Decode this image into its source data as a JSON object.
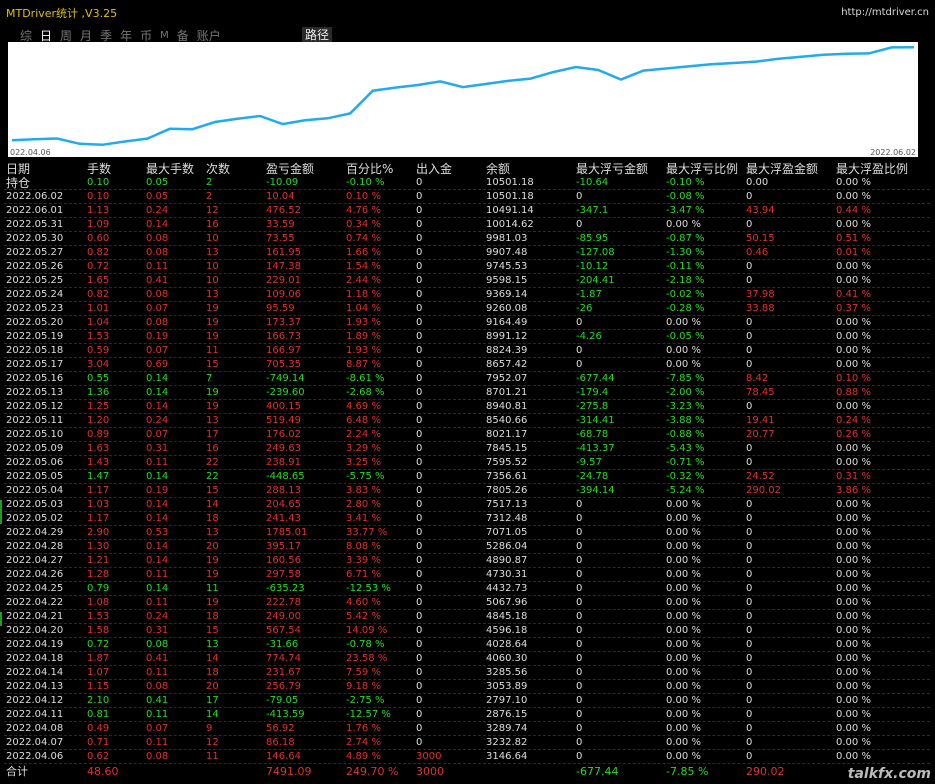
{
  "app": {
    "title": "MTDriver统计 ,V3.25",
    "url": "http://mtdriver.cn",
    "watermark": "talkfx.com"
  },
  "tabs": [
    {
      "label": "综",
      "active": false
    },
    {
      "label": "日",
      "active": true
    },
    {
      "label": "周",
      "active": false
    },
    {
      "label": "月",
      "active": false
    },
    {
      "label": "季",
      "active": false
    },
    {
      "label": "年",
      "active": false
    },
    {
      "label": "币",
      "active": false
    },
    {
      "label": "M",
      "active": false
    },
    {
      "label": "备",
      "active": false
    },
    {
      "label": "账户",
      "active": false
    }
  ],
  "path_button": "路径",
  "chart": {
    "start_label": "022.04.06",
    "end_label": "2022.06.02",
    "line_color": "#22aaee"
  },
  "chart_data": {
    "type": "line",
    "x": [
      "2022.04.06",
      "2022.04.07",
      "2022.04.08",
      "2022.04.11",
      "2022.04.12",
      "2022.04.13",
      "2022.04.14",
      "2022.04.18",
      "2022.04.19",
      "2022.04.20",
      "2022.04.21",
      "2022.04.22",
      "2022.04.25",
      "2022.04.26",
      "2022.04.27",
      "2022.04.28",
      "2022.04.29",
      "2022.05.02",
      "2022.05.03",
      "2022.05.04",
      "2022.05.05",
      "2022.05.06",
      "2022.05.09",
      "2022.05.10",
      "2022.05.11",
      "2022.05.12",
      "2022.05.13",
      "2022.05.16",
      "2022.05.17",
      "2022.05.18",
      "2022.05.19",
      "2022.05.20",
      "2022.05.23",
      "2022.05.24",
      "2022.05.25",
      "2022.05.26",
      "2022.05.27",
      "2022.05.30",
      "2022.05.31",
      "2022.06.01",
      "2022.06.02"
    ],
    "series": [
      {
        "values": [
          3146.64,
          3232.82,
          3289.74,
          2876.15,
          2797.1,
          3053.89,
          3285.56,
          4060.3,
          4028.64,
          4596.18,
          4845.18,
          5067.96,
          4432.73,
          4730.31,
          4890.87,
          5286.04,
          7071.05,
          7312.48,
          7517.13,
          7805.26,
          7356.61,
          7595.52,
          7845.15,
          8021.17,
          8540.66,
          8940.81,
          8701.21,
          7952.07,
          8657.42,
          8824.39,
          8991.12,
          9164.49,
          9260.08,
          9369.14,
          9598.15,
          9745.53,
          9907.48,
          9981.03,
          10014.62,
          10491.14,
          10501.18
        ]
      }
    ],
    "ylim": [
      2700,
      10600
    ]
  },
  "columns": [
    "日期",
    "手数",
    "最大手数",
    "次数",
    "盈亏金额",
    "百分比%",
    "出入金",
    "余额",
    "最大浮亏金额",
    "最大浮亏比例",
    "最大浮盈金额",
    "最大浮盈比例"
  ],
  "position": {
    "date": "持仓",
    "lots": "0.10",
    "max_lots": "0.05",
    "count": "2",
    "pl": "-10.09",
    "pct": "-0.10 %",
    "io": "0",
    "balance": "10501.18",
    "max_fl": "-10.64",
    "max_fl_pct": "-0.10 %",
    "max_fp": "0.00",
    "max_fp_pct": "0.00 %"
  },
  "rows": [
    {
      "date": "2022.06.02",
      "lots": "0.10",
      "max_lots": "0.05",
      "count": "2",
      "pl": "10.04",
      "pct": "0.10 %",
      "io": "0",
      "balance": "10501.18",
      "max_fl": "0",
      "max_fl_pct": "-0.08 %",
      "max_fp": "0",
      "max_fp_pct": "0.00 %"
    },
    {
      "date": "2022.06.01",
      "lots": "1.13",
      "max_lots": "0.24",
      "count": "12",
      "pl": "476.52",
      "pct": "4.76 %",
      "io": "0",
      "balance": "10491.14",
      "max_fl": "-347.1",
      "max_fl_pct": "-3.47 %",
      "max_fp": "43.94",
      "max_fp_pct": "0.44 %"
    },
    {
      "date": "2022.05.31",
      "lots": "1.09",
      "max_lots": "0.14",
      "count": "16",
      "pl": "33.59",
      "pct": "0.34 %",
      "io": "0",
      "balance": "10014.62",
      "max_fl": "0",
      "max_fl_pct": "0.00 %",
      "max_fp": "0",
      "max_fp_pct": "0.00 %"
    },
    {
      "date": "2022.05.30",
      "lots": "0.60",
      "max_lots": "0.08",
      "count": "10",
      "pl": "73.55",
      "pct": "0.74 %",
      "io": "0",
      "balance": "9981.03",
      "max_fl": "-85.95",
      "max_fl_pct": "-0.87 %",
      "max_fp": "50.15",
      "max_fp_pct": "0.51 %"
    },
    {
      "date": "2022.05.27",
      "lots": "0.82",
      "max_lots": "0.08",
      "count": "13",
      "pl": "161.95",
      "pct": "1.66 %",
      "io": "0",
      "balance": "9907.48",
      "max_fl": "-127.08",
      "max_fl_pct": "-1.30 %",
      "max_fp": "0.46",
      "max_fp_pct": "0.01 %"
    },
    {
      "date": "2022.05.26",
      "lots": "0.72",
      "max_lots": "0.11",
      "count": "10",
      "pl": "147.38",
      "pct": "1.54 %",
      "io": "0",
      "balance": "9745.53",
      "max_fl": "-10.12",
      "max_fl_pct": "-0.11 %",
      "max_fp": "0",
      "max_fp_pct": "0.00 %"
    },
    {
      "date": "2022.05.25",
      "lots": "1.65",
      "max_lots": "0.41",
      "count": "10",
      "pl": "229.01",
      "pct": "2.44 %",
      "io": "0",
      "balance": "9598.15",
      "max_fl": "-204.41",
      "max_fl_pct": "-2.18 %",
      "max_fp": "0",
      "max_fp_pct": "0.00 %"
    },
    {
      "date": "2022.05.24",
      "lots": "0.82",
      "max_lots": "0.08",
      "count": "13",
      "pl": "109.06",
      "pct": "1.18 %",
      "io": "0",
      "balance": "9369.14",
      "max_fl": "-1.87",
      "max_fl_pct": "-0.02 %",
      "max_fp": "37.98",
      "max_fp_pct": "0.41 %"
    },
    {
      "date": "2022.05.23",
      "lots": "1.01",
      "max_lots": "0.07",
      "count": "19",
      "pl": "95.59",
      "pct": "1.04 %",
      "io": "0",
      "balance": "9260.08",
      "max_fl": "-26",
      "max_fl_pct": "-0.28 %",
      "max_fp": "33.88",
      "max_fp_pct": "0.37 %"
    },
    {
      "date": "2022.05.20",
      "lots": "1.04",
      "max_lots": "0.08",
      "count": "19",
      "pl": "173.37",
      "pct": "1.93 %",
      "io": "0",
      "balance": "9164.49",
      "max_fl": "0",
      "max_fl_pct": "0.00 %",
      "max_fp": "0",
      "max_fp_pct": "0.00 %"
    },
    {
      "date": "2022.05.19",
      "lots": "1.53",
      "max_lots": "0.19",
      "count": "19",
      "pl": "166.73",
      "pct": "1.89 %",
      "io": "0",
      "balance": "8991.12",
      "max_fl": "-4.26",
      "max_fl_pct": "-0.05 %",
      "max_fp": "0",
      "max_fp_pct": "0.00 %"
    },
    {
      "date": "2022.05.18",
      "lots": "0.59",
      "max_lots": "0.07",
      "count": "11",
      "pl": "166.97",
      "pct": "1.93 %",
      "io": "0",
      "balance": "8824.39",
      "max_fl": "0",
      "max_fl_pct": "0.00 %",
      "max_fp": "0",
      "max_fp_pct": "0.00 %"
    },
    {
      "date": "2022.05.17",
      "lots": "3.04",
      "max_lots": "0.69",
      "count": "15",
      "pl": "705.35",
      "pct": "8.87 %",
      "io": "0",
      "balance": "8657.42",
      "max_fl": "0",
      "max_fl_pct": "0.00 %",
      "max_fp": "0",
      "max_fp_pct": "0.00 %"
    },
    {
      "date": "2022.05.16",
      "lots": "0.55",
      "max_lots": "0.14",
      "count": "7",
      "pl": "-749.14",
      "pct": "-8.61 %",
      "io": "0",
      "balance": "7952.07",
      "max_fl": "-677.44",
      "max_fl_pct": "-7.85 %",
      "max_fp": "8.42",
      "max_fp_pct": "0.10 %"
    },
    {
      "date": "2022.05.13",
      "lots": "1.36",
      "max_lots": "0.14",
      "count": "19",
      "pl": "-239.60",
      "pct": "-2.68 %",
      "io": "0",
      "balance": "8701.21",
      "max_fl": "-179.4",
      "max_fl_pct": "-2.00 %",
      "max_fp": "78.45",
      "max_fp_pct": "0.88 %"
    },
    {
      "date": "2022.05.12",
      "lots": "1.25",
      "max_lots": "0.14",
      "count": "19",
      "pl": "400.15",
      "pct": "4.69 %",
      "io": "0",
      "balance": "8940.81",
      "max_fl": "-275.8",
      "max_fl_pct": "-3.23 %",
      "max_fp": "0",
      "max_fp_pct": "0.00 %"
    },
    {
      "date": "2022.05.11",
      "lots": "1.20",
      "max_lots": "0.24",
      "count": "13",
      "pl": "519.49",
      "pct": "6.48 %",
      "io": "0",
      "balance": "8540.66",
      "max_fl": "-314.41",
      "max_fl_pct": "-3.88 %",
      "max_fp": "19.41",
      "max_fp_pct": "0.24 %"
    },
    {
      "date": "2022.05.10",
      "lots": "0.89",
      "max_lots": "0.07",
      "count": "17",
      "pl": "176.02",
      "pct": "2.24 %",
      "io": "0",
      "balance": "8021.17",
      "max_fl": "-68.78",
      "max_fl_pct": "-0.88 %",
      "max_fp": "20.77",
      "max_fp_pct": "0.26 %"
    },
    {
      "date": "2022.05.09",
      "lots": "1.63",
      "max_lots": "0.31",
      "count": "16",
      "pl": "249.63",
      "pct": "3.29 %",
      "io": "0",
      "balance": "7845.15",
      "max_fl": "-413.37",
      "max_fl_pct": "-5.43 %",
      "max_fp": "0",
      "max_fp_pct": "0.00 %"
    },
    {
      "date": "2022.05.06",
      "lots": "1.43",
      "max_lots": "0.11",
      "count": "22",
      "pl": "238.91",
      "pct": "3.25 %",
      "io": "0",
      "balance": "7595.52",
      "max_fl": "-9.57",
      "max_fl_pct": "-0.71 %",
      "max_fp": "0",
      "max_fp_pct": "0.00 %"
    },
    {
      "date": "2022.05.05",
      "lots": "1.47",
      "max_lots": "0.14",
      "count": "22",
      "pl": "-448.65",
      "pct": "-5.75 %",
      "io": "0",
      "balance": "7356.61",
      "max_fl": "-24.78",
      "max_fl_pct": "-0.32 %",
      "max_fp": "24.52",
      "max_fp_pct": "0.31 %"
    },
    {
      "date": "2022.05.04",
      "lots": "1.17",
      "max_lots": "0.19",
      "count": "15",
      "pl": "288.13",
      "pct": "3.83 %",
      "io": "0",
      "balance": "7805.26",
      "max_fl": "-394.14",
      "max_fl_pct": "-5.24 %",
      "max_fp": "290.02",
      "max_fp_pct": "3.86 %"
    },
    {
      "date": "2022.05.03",
      "lots": "1.03",
      "max_lots": "0.14",
      "count": "14",
      "pl": "204.65",
      "pct": "2.80 %",
      "io": "0",
      "balance": "7517.13",
      "max_fl": "0",
      "max_fl_pct": "0.00 %",
      "max_fp": "0",
      "max_fp_pct": "0.00 %"
    },
    {
      "date": "2022.05.02",
      "lots": "1.17",
      "max_lots": "0.14",
      "count": "18",
      "pl": "241.43",
      "pct": "3.41 %",
      "io": "0",
      "balance": "7312.48",
      "max_fl": "0",
      "max_fl_pct": "0.00 %",
      "max_fp": "0",
      "max_fp_pct": "0.00 %"
    },
    {
      "date": "2022.04.29",
      "lots": "2.90",
      "max_lots": "0.53",
      "count": "13",
      "pl": "1785.01",
      "pct": "33.77 %",
      "io": "0",
      "balance": "7071.05",
      "max_fl": "0",
      "max_fl_pct": "0.00 %",
      "max_fp": "0",
      "max_fp_pct": "0.00 %"
    },
    {
      "date": "2022.04.28",
      "lots": "1.30",
      "max_lots": "0.14",
      "count": "20",
      "pl": "395.17",
      "pct": "8.08 %",
      "io": "0",
      "balance": "5286.04",
      "max_fl": "0",
      "max_fl_pct": "0.00 %",
      "max_fp": "0",
      "max_fp_pct": "0.00 %"
    },
    {
      "date": "2022.04.27",
      "lots": "1.21",
      "max_lots": "0.14",
      "count": "19",
      "pl": "160.56",
      "pct": "3.39 %",
      "io": "0",
      "balance": "4890.87",
      "max_fl": "0",
      "max_fl_pct": "0.00 %",
      "max_fp": "0",
      "max_fp_pct": "0.00 %"
    },
    {
      "date": "2022.04.26",
      "lots": "1.28",
      "max_lots": "0.11",
      "count": "19",
      "pl": "297.58",
      "pct": "6.71 %",
      "io": "0",
      "balance": "4730.31",
      "max_fl": "0",
      "max_fl_pct": "0.00 %",
      "max_fp": "0",
      "max_fp_pct": "0.00 %"
    },
    {
      "date": "2022.04.25",
      "lots": "0.79",
      "max_lots": "0.14",
      "count": "11",
      "pl": "-635.23",
      "pct": "-12.53 %",
      "io": "0",
      "balance": "4432.73",
      "max_fl": "0",
      "max_fl_pct": "0.00 %",
      "max_fp": "0",
      "max_fp_pct": "0.00 %"
    },
    {
      "date": "2022.04.22",
      "lots": "1.08",
      "max_lots": "0.11",
      "count": "19",
      "pl": "222.78",
      "pct": "4.60 %",
      "io": "0",
      "balance": "5067.96",
      "max_fl": "0",
      "max_fl_pct": "0.00 %",
      "max_fp": "0",
      "max_fp_pct": "0.00 %"
    },
    {
      "date": "2022.04.21",
      "lots": "1.53",
      "max_lots": "0.24",
      "count": "18",
      "pl": "249.00",
      "pct": "5.42 %",
      "io": "0",
      "balance": "4845.18",
      "max_fl": "0",
      "max_fl_pct": "0.00 %",
      "max_fp": "0",
      "max_fp_pct": "0.00 %"
    },
    {
      "date": "2022.04.20",
      "lots": "1.58",
      "max_lots": "0.31",
      "count": "15",
      "pl": "567.54",
      "pct": "14.09 %",
      "io": "0",
      "balance": "4596.18",
      "max_fl": "0",
      "max_fl_pct": "0.00 %",
      "max_fp": "0",
      "max_fp_pct": "0.00 %"
    },
    {
      "date": "2022.04.19",
      "lots": "0.72",
      "max_lots": "0.08",
      "count": "13",
      "pl": "-31.66",
      "pct": "-0.78 %",
      "io": "0",
      "balance": "4028.64",
      "max_fl": "0",
      "max_fl_pct": "0.00 %",
      "max_fp": "0",
      "max_fp_pct": "0.00 %"
    },
    {
      "date": "2022.04.18",
      "lots": "1.87",
      "max_lots": "0.41",
      "count": "14",
      "pl": "774.74",
      "pct": "23.58 %",
      "io": "0",
      "balance": "4060.30",
      "max_fl": "0",
      "max_fl_pct": "0.00 %",
      "max_fp": "0",
      "max_fp_pct": "0.00 %"
    },
    {
      "date": "2022.04.14",
      "lots": "1.07",
      "max_lots": "0.11",
      "count": "18",
      "pl": "231.67",
      "pct": "7.59 %",
      "io": "0",
      "balance": "3285.56",
      "max_fl": "0",
      "max_fl_pct": "0.00 %",
      "max_fp": "0",
      "max_fp_pct": "0.00 %"
    },
    {
      "date": "2022.04.13",
      "lots": "1.15",
      "max_lots": "0.08",
      "count": "20",
      "pl": "256.79",
      "pct": "9.18 %",
      "io": "0",
      "balance": "3053.89",
      "max_fl": "0",
      "max_fl_pct": "0.00 %",
      "max_fp": "0",
      "max_fp_pct": "0.00 %"
    },
    {
      "date": "2022.04.12",
      "lots": "2.10",
      "max_lots": "0.41",
      "count": "17",
      "pl": "-79.05",
      "pct": "-2.75 %",
      "io": "0",
      "balance": "2797.10",
      "max_fl": "0",
      "max_fl_pct": "0.00 %",
      "max_fp": "0",
      "max_fp_pct": "0.00 %"
    },
    {
      "date": "2022.04.11",
      "lots": "0.81",
      "max_lots": "0.11",
      "count": "14",
      "pl": "-413.59",
      "pct": "-12.57 %",
      "io": "0",
      "balance": "2876.15",
      "max_fl": "0",
      "max_fl_pct": "0.00 %",
      "max_fp": "0",
      "max_fp_pct": "0.00 %"
    },
    {
      "date": "2022.04.08",
      "lots": "0.49",
      "max_lots": "0.07",
      "count": "9",
      "pl": "56.92",
      "pct": "1.76 %",
      "io": "0",
      "balance": "3289.74",
      "max_fl": "0",
      "max_fl_pct": "0.00 %",
      "max_fp": "0",
      "max_fp_pct": "0.00 %"
    },
    {
      "date": "2022.04.07",
      "lots": "0.71",
      "max_lots": "0.11",
      "count": "12",
      "pl": "86.18",
      "pct": "2.74 %",
      "io": "0",
      "balance": "3232.82",
      "max_fl": "0",
      "max_fl_pct": "0.00 %",
      "max_fp": "0",
      "max_fp_pct": "0.00 %"
    },
    {
      "date": "2022.04.06",
      "lots": "0.62",
      "max_lots": "0.08",
      "count": "11",
      "pl": "146.64",
      "pct": "4.89 %",
      "io": "3000",
      "balance": "3146.64",
      "max_fl": "0",
      "max_fl_pct": "0.00 %",
      "max_fp": "0",
      "max_fp_pct": "0.00 %"
    }
  ],
  "total": {
    "label": "合计",
    "lots": "48.60",
    "pl": "7491.09",
    "pct": "249.70 %",
    "io": "3000",
    "max_fl": "-677.44",
    "max_fl_pct": "-7.85 %",
    "max_fp": "290.02"
  },
  "colors": {
    "positive": "#e03030",
    "negative": "#22dd22",
    "neutral": "#dddddd",
    "title": "#e0c000"
  }
}
